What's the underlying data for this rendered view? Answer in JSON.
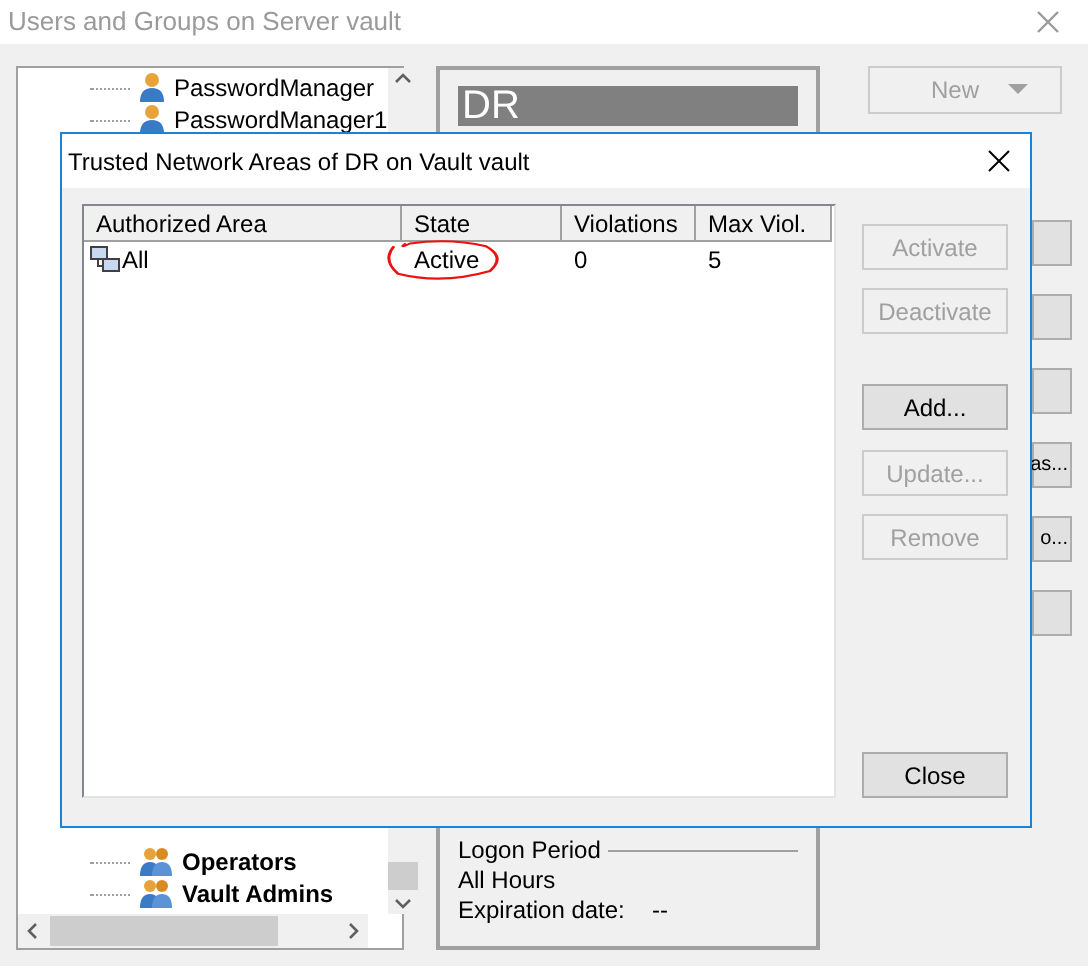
{
  "window": {
    "title": "Users and Groups on Server vault"
  },
  "tree": {
    "top_items": [
      {
        "label": "PasswordManager",
        "kind": "user",
        "bold": false
      },
      {
        "label": "PasswordManager1",
        "kind": "user",
        "bold": false
      }
    ],
    "bottom_items": [
      {
        "label": "Operators",
        "kind": "group",
        "bold": true
      },
      {
        "label": "Vault Admins",
        "kind": "group",
        "bold": true
      }
    ]
  },
  "details": {
    "header": "DR",
    "logon_period": "Logon Period",
    "logon_value": "All Hours",
    "expiration_label": "Expiration date:",
    "expiration_value": "--"
  },
  "new_button": {
    "label": "New",
    "disabled": true
  },
  "side_buttons": [
    {
      "kind": "blank"
    },
    {
      "kind": "blank"
    },
    {
      "kind": "blank"
    },
    {
      "kind": "text",
      "label": "as..."
    },
    {
      "kind": "text",
      "label": "o..."
    },
    {
      "kind": "blank"
    }
  ],
  "dialog": {
    "title": "Trusted Network Areas of DR on Vault vault",
    "columns": [
      "Authorized Area",
      "State",
      "Violations",
      "Max Viol."
    ],
    "rows": [
      {
        "area": "All",
        "state": "Active",
        "violations": "0",
        "max_viol": "5",
        "circled": true
      }
    ],
    "buttons": [
      {
        "label": "Activate",
        "disabled": true
      },
      {
        "label": "Deactivate",
        "disabled": true
      },
      {
        "label": "Add...",
        "disabled": false
      },
      {
        "label": "Update...",
        "disabled": true
      },
      {
        "label": "Remove",
        "disabled": true
      }
    ],
    "close": "Close"
  }
}
